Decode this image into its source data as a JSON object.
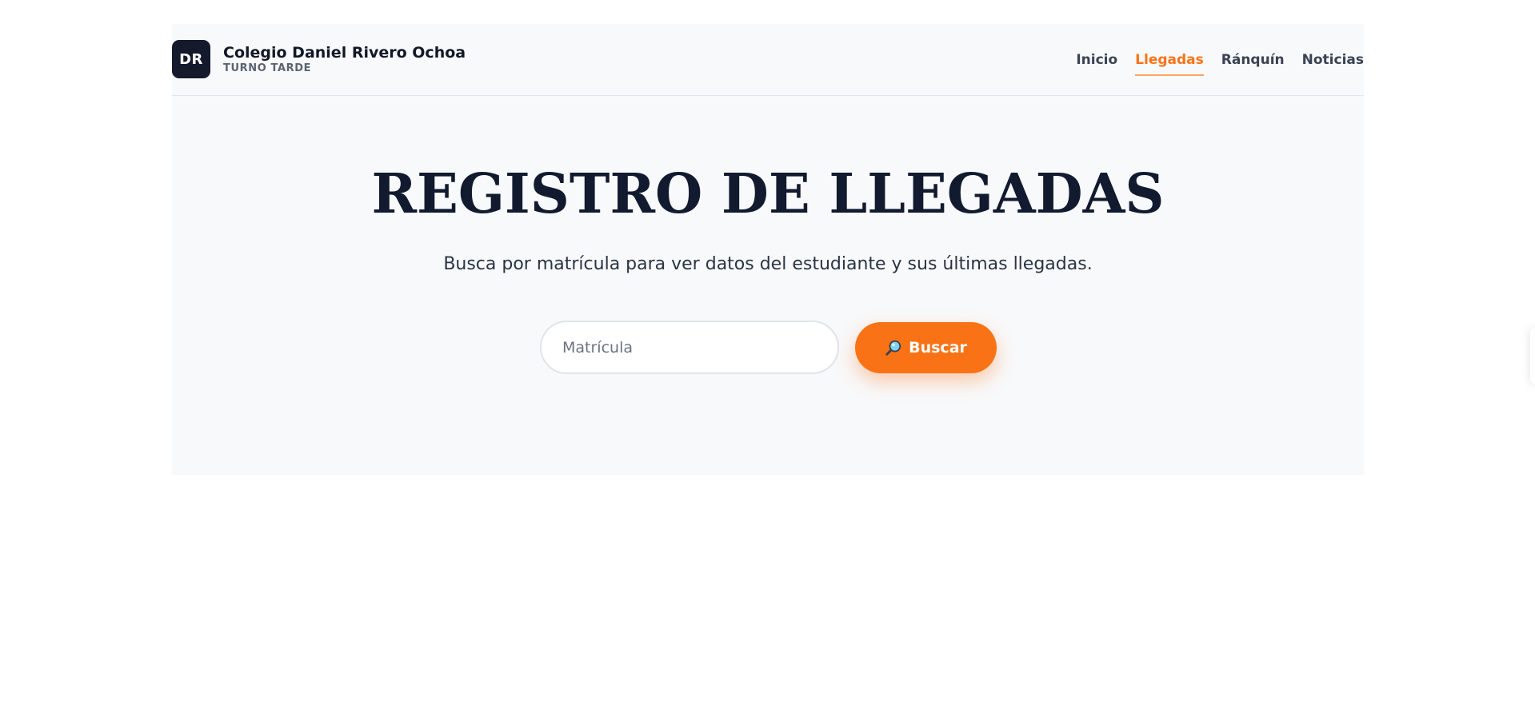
{
  "brand": {
    "logo_text": "DR",
    "school_name": "Colegio Daniel Rivero Ochoa",
    "shift": "TURNO TARDE"
  },
  "nav": {
    "items": [
      {
        "label": "Inicio",
        "active": false
      },
      {
        "label": "Llegadas",
        "active": true
      },
      {
        "label": "Ránquín",
        "active": false
      },
      {
        "label": "Noticias",
        "active": false
      }
    ]
  },
  "hero": {
    "title": "REGISTRO DE LLEGADAS",
    "subtitle": "Busca por matrícula para ver datos del estudiante y sus últimas llegadas."
  },
  "search": {
    "placeholder": "Matrícula",
    "value": "",
    "button_label": "Buscar",
    "button_icon": "magnifying-glass-icon"
  },
  "colors": {
    "accent": "#f97316",
    "logo_background": "#141a2b",
    "title": "#111a2e",
    "panel_background": "#f8f9fa"
  }
}
